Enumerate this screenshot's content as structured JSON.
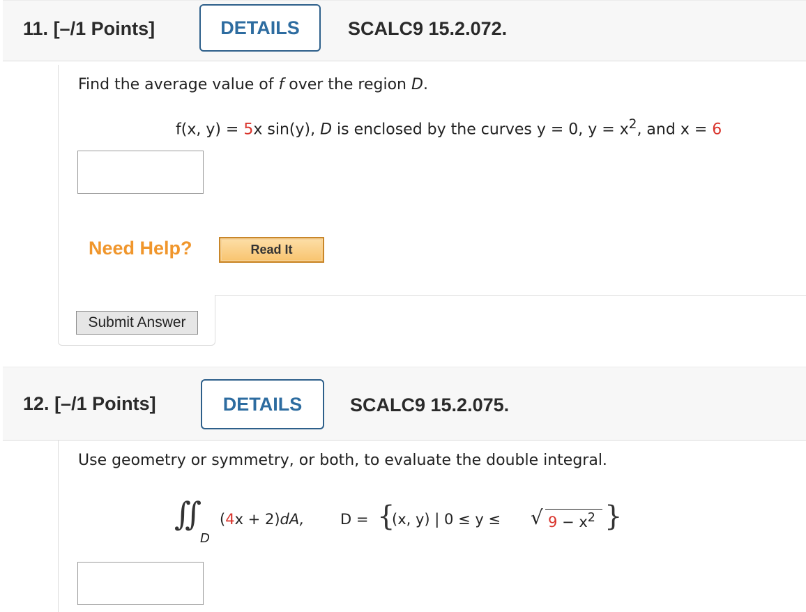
{
  "q11": {
    "number": "11.",
    "points": "[–/1 Points]",
    "details_label": "DETAILS",
    "code": "SCALC9 15.2.072.",
    "prompt_parts": [
      "Find the average value of ",
      "f",
      " over the region ",
      "D",
      "."
    ],
    "formula": {
      "f_lhs": "f(x, y) = ",
      "coef": "5",
      "f_rest": "x sin(y), ",
      "D": "D",
      "enclosed": " is enclosed by the curves ",
      "c1": "y = 0, ",
      "c2": "y = x",
      "exp": "2",
      "and": ", and ",
      "x_eq": "x = ",
      "x_val": "6"
    },
    "answer_value": "",
    "need_help": "Need Help?",
    "read_it": "Read It",
    "submit": "Submit Answer"
  },
  "q12": {
    "number": "12.",
    "points": "[–/1 Points]",
    "details_label": "DETAILS",
    "code": "SCALC9 15.2.075.",
    "prompt": "Use geometry or symmetry, or both, to evaluate the double integral.",
    "formula": {
      "integral_sign": "∬",
      "sub": "D",
      "open": "(",
      "coef": "4",
      "rest1": "x + 2)",
      "dA": "dA,",
      "D_eq": "D = ",
      "brace_open": "{",
      "set_text": "(x, y) | 0 ≤ y ≤ ",
      "sqrt_sign": "√",
      "radicand_num": "9",
      "radicand_rest": " − x",
      "radicand_exp": "2",
      "brace_close": "}"
    },
    "answer_value": ""
  }
}
